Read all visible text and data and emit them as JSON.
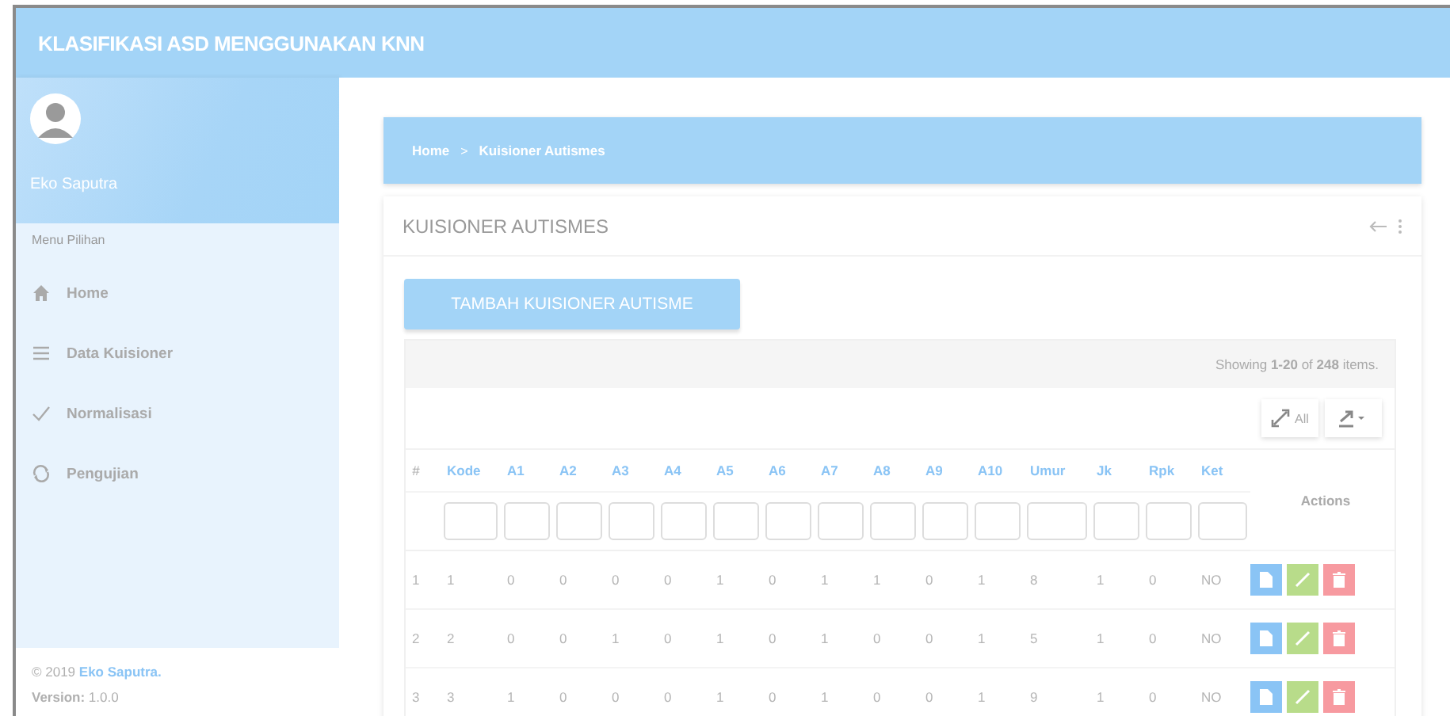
{
  "app_title": "KLASIFIKASI ASD MENGGUNAKAN KNN",
  "sidebar": {
    "user_name": "Eko Saputra",
    "menu_heading": "Menu Pilihan",
    "items": [
      {
        "label": "Home",
        "kind": "home"
      },
      {
        "label": "Data Kuisioner",
        "kind": "list"
      },
      {
        "label": "Normalisasi",
        "kind": "check"
      },
      {
        "label": "Pengujian",
        "kind": "sync"
      }
    ],
    "footer": {
      "copyright": "© 2019",
      "author_link": "Eko Saputra.",
      "version": "**Version:** 1.0.0"
    }
  },
  "breadcrumb": {
    "separator": ">",
    "items": [
      {
        "label": "Home"
      },
      {
        "label": "Kuisioner Autismes"
      }
    ]
  },
  "card": {
    "title": "KUISIONER AUTISMES",
    "add_button": "TAMBAH KUISIONER AUTISME",
    "summary": "Showing **1-20** of **248** items.",
    "toggle_all": "All",
    "table": {
      "columns": [
        {
          "label": "#",
          "sortable": false,
          "filter": false
        },
        {
          "label": "Kode",
          "sortable": true,
          "filter": true
        },
        {
          "label": "A1",
          "sortable": true,
          "filter": true
        },
        {
          "label": "A2",
          "sortable": true,
          "filter": true
        },
        {
          "label": "A3",
          "sortable": true,
          "filter": true
        },
        {
          "label": "A4",
          "sortable": true,
          "filter": true
        },
        {
          "label": "A5",
          "sortable": true,
          "filter": true
        },
        {
          "label": "A6",
          "sortable": true,
          "filter": true
        },
        {
          "label": "A7",
          "sortable": true,
          "filter": true
        },
        {
          "label": "A8",
          "sortable": true,
          "filter": true
        },
        {
          "label": "A9",
          "sortable": true,
          "filter": true
        },
        {
          "label": "A10",
          "sortable": true,
          "filter": true
        },
        {
          "label": "Umur",
          "sortable": true,
          "filter": true
        },
        {
          "label": "Jk",
          "sortable": true,
          "filter": true
        },
        {
          "label": "Rpk",
          "sortable": true,
          "filter": true
        },
        {
          "label": "Ket",
          "sortable": true,
          "filter": true
        }
      ],
      "actions_label": "Actions",
      "rows": [
        [
          "1",
          "1",
          "0",
          "0",
          "0",
          "0",
          "1",
          "0",
          "1",
          "1",
          "0",
          "1",
          "8",
          "1",
          "0",
          "NO"
        ],
        [
          "2",
          "2",
          "0",
          "0",
          "1",
          "0",
          "1",
          "0",
          "1",
          "0",
          "0",
          "1",
          "5",
          "1",
          "0",
          "NO"
        ],
        [
          "3",
          "3",
          "1",
          "0",
          "0",
          "0",
          "1",
          "0",
          "1",
          "0",
          "0",
          "1",
          "9",
          "1",
          "0",
          "NO"
        ]
      ]
    }
  }
}
